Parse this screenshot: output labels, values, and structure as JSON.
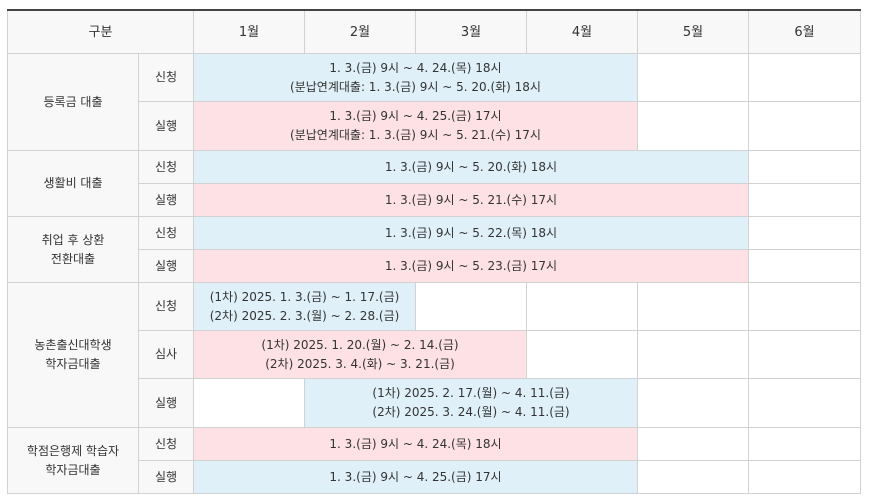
{
  "header": {
    "category": "구분",
    "months": [
      "1월",
      "2월",
      "3월",
      "4월",
      "5월",
      "6월"
    ]
  },
  "groups": [
    {
      "title": "등록금 대출",
      "rows": [
        {
          "phase": "신청",
          "lines": [
            "1. 3.(금) 9시 ~ 4. 24.(목) 18시",
            "(분납연계대출: 1. 3.(금) 9시 ~ 5. 20.(화) 18시"
          ]
        },
        {
          "phase": "실행",
          "lines": [
            "1. 3.(금) 9시 ~ 4. 25.(금) 17시",
            "(분납연계대출: 1. 3.(금) 9시 ~ 5. 21.(수) 17시"
          ]
        }
      ]
    },
    {
      "title": "생활비 대출",
      "rows": [
        {
          "phase": "신청",
          "lines": [
            "1. 3.(금) 9시 ~ 5. 20.(화) 18시"
          ]
        },
        {
          "phase": "실행",
          "lines": [
            "1. 3.(금) 9시 ~ 5. 21.(수) 17시"
          ]
        }
      ]
    },
    {
      "title_lines": [
        "취업 후 상환",
        "전환대출"
      ],
      "rows": [
        {
          "phase": "신청",
          "lines": [
            "1. 3.(금) 9시 ~ 5. 22.(목) 18시"
          ]
        },
        {
          "phase": "실행",
          "lines": [
            "1. 3.(금) 9시 ~ 5. 23.(금) 17시"
          ]
        }
      ]
    },
    {
      "title_lines": [
        "농촌출신대학생",
        "학자금대출"
      ],
      "rows": [
        {
          "phase": "신청",
          "lines": [
            "(1차) 2025. 1. 3.(금) ~ 1. 17.(금)",
            "(2차) 2025. 2. 3.(월) ~ 2. 28.(금)"
          ]
        },
        {
          "phase": "심사",
          "lines": [
            "(1차) 2025. 1. 20.(월) ~ 2. 14.(금)",
            "(2차) 2025. 3. 4.(화) ~ 3. 21.(금)"
          ]
        },
        {
          "phase": "실행",
          "lines": [
            "(1차) 2025. 2. 17.(월) ~ 4. 11.(금)",
            "(2차) 2025. 3. 24.(월) ~ 4. 11.(금)"
          ]
        }
      ]
    },
    {
      "title_lines": [
        "학점은행제 학습자",
        "학자금대출"
      ],
      "rows": [
        {
          "phase": "신청",
          "lines": [
            "1. 3.(금) 9시 ~ 4. 24.(목) 18시"
          ]
        },
        {
          "phase": "실행",
          "lines": [
            "1. 3.(금) 9시 ~ 4. 25.(금) 17시"
          ]
        }
      ]
    }
  ],
  "colors": {
    "apply_fill": "#dff0f9",
    "execute_fill": "#fde1e4",
    "label_bg": "#f8f8f8"
  }
}
